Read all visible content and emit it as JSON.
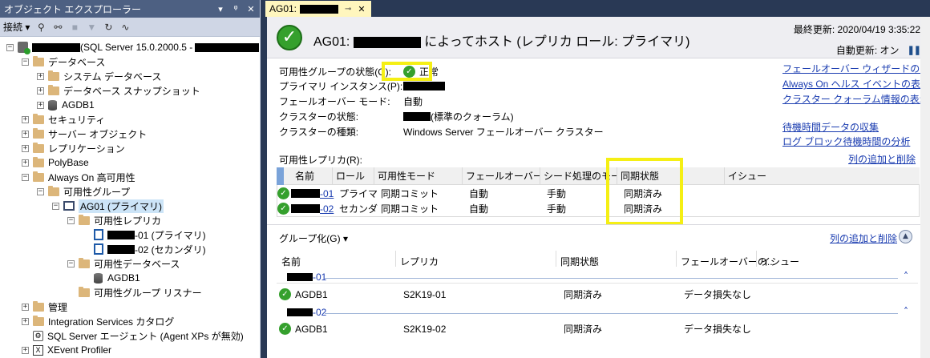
{
  "object_explorer": {
    "title": "オブジェクト エクスプローラー",
    "window_btns": [
      "▾",
      "ᵠ",
      "✕"
    ],
    "toolbar": {
      "connect_label": "接続 ▾"
    },
    "tree": {
      "server_suffix": "(SQL Server 15.0.2000.5 -",
      "databases": "データベース",
      "system_db": "システム データベース",
      "db_snapshots": "データベース スナップショット",
      "agdb1": "AGDB1",
      "security": "セキュリティ",
      "server_objects": "サーバー オブジェクト",
      "replication": "レプリケーション",
      "polybase": "PolyBase",
      "always_on": "Always On 高可用性",
      "ag_groups": "可用性グループ",
      "ag01": "AG01 (プライマリ)",
      "ag_replicas": "可用性レプリカ",
      "replica1": "-01 (プライマリ)",
      "replica2": "-02 (セカンダリ)",
      "ag_databases": "可用性データベース",
      "ag_agdb1": "AGDB1",
      "ag_listener": "可用性グループ リスナー",
      "management": "管理",
      "is_catalog": "Integration Services カタログ",
      "sql_agent": "SQL Server エージェント (Agent XPs が無効)",
      "xevent": "XEvent Profiler"
    }
  },
  "tab": {
    "label": "AG01:",
    "pin": "⊸",
    "close": "✕"
  },
  "dashboard": {
    "title_prefix": "AG01:",
    "title_suffix": "によってホスト (レプリカ ロール: プライマリ)",
    "last_update": "最終更新: 2020/04/19 3:35:22",
    "auto_update": "自動更新: オン",
    "pause_icon": "❚❚",
    "info": {
      "ag_state_label": "可用性グループの状態(G):",
      "ag_state_value": "正常",
      "primary_label": "プライマリ インスタンス(P):",
      "failover_label": "フェールオーバー モード:",
      "failover_value": "自動",
      "cluster_state_label": "クラスターの状態:",
      "cluster_state_value": "(標準のクォーラム)",
      "cluster_type_label": "クラスターの種類:",
      "cluster_type_value": "Windows Server フェールオーバー クラスター"
    },
    "links": {
      "failover_wizard": "フェールオーバー ウィザードの開始",
      "health_events": "Always On ヘルス イベントの表示(L)",
      "quorum_info": "クラスター クォーラム情報の表示",
      "collect_latency": "待機時間データの収集",
      "log_block": "ログ ブロック待機時間の分析"
    },
    "replicas_label": "可用性レプリカ(R):",
    "add_remove_cols": "列の追加と削除",
    "replica_grid": {
      "headers": [
        "名前",
        "ロール",
        "可用性モード",
        "フェールオーバー ...",
        "シード処理のモード",
        "同期状態",
        "イシュー"
      ],
      "rows": [
        {
          "name": "-01",
          "role": "プライマリ",
          "mode": "同期コミット",
          "failover": "自動",
          "seeding": "手動",
          "sync": "同期済み"
        },
        {
          "name": "-02",
          "role": "セカンダリ",
          "mode": "同期コミット",
          "failover": "自動",
          "seeding": "手動",
          "sync": "同期済み"
        }
      ]
    },
    "group_by": "グループ化(G) ▾",
    "db_grid": {
      "headers": [
        "名前",
        "レプリカ",
        "同期状態",
        "フェールオーバーの...",
        "イシュー"
      ],
      "groups": [
        {
          "label": "-01",
          "rows": [
            {
              "name": "AGDB1",
              "replica": "S2K19-01",
              "sync": "同期済み",
              "failover": "データ損失なし"
            }
          ]
        },
        {
          "label": "-02",
          "rows": [
            {
              "name": "AGDB1",
              "replica": "S2K19-02",
              "sync": "同期済み",
              "failover": "データ損失なし"
            }
          ]
        }
      ]
    }
  },
  "colors": {
    "highlight": "#f5ef14",
    "ok": "#35a02d",
    "link": "#1a3cb0"
  }
}
